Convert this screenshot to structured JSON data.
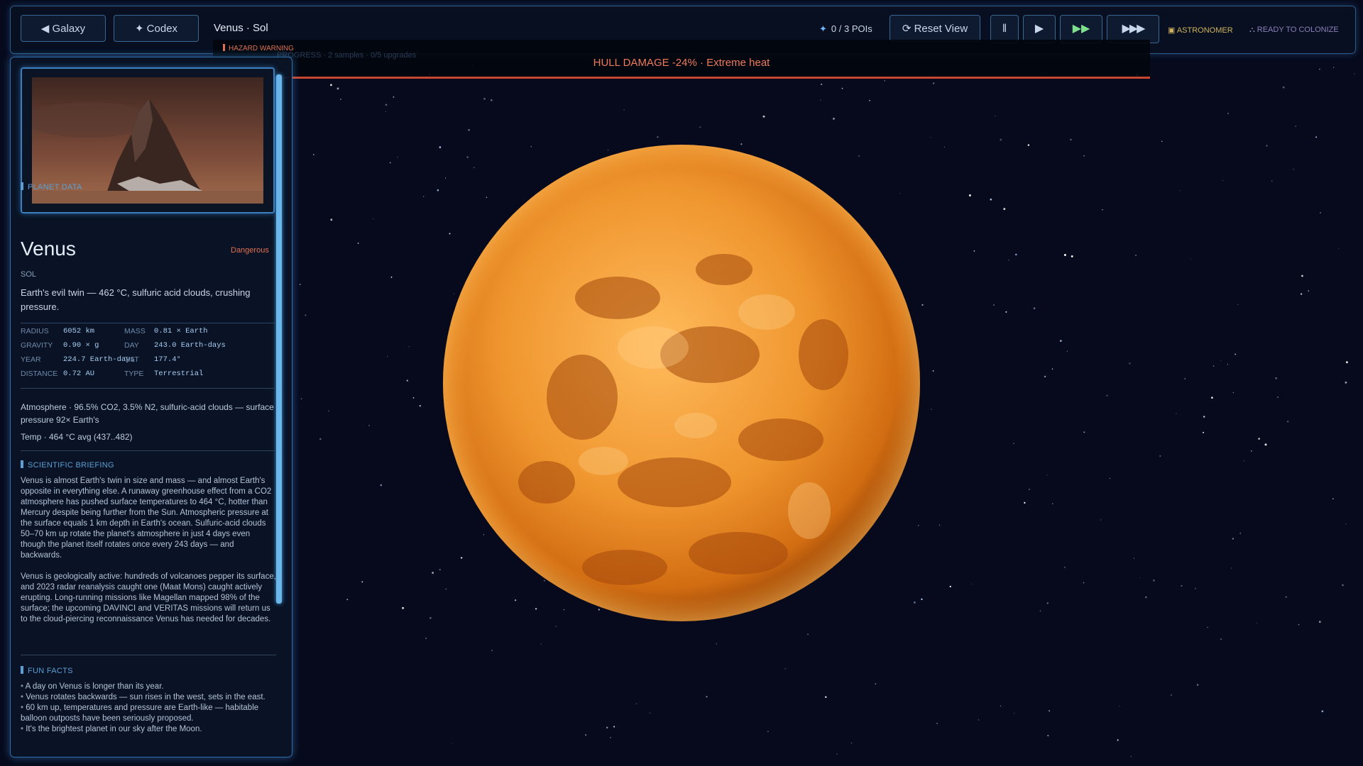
{
  "nav": {
    "galaxy_label": "◀ Galaxy",
    "codex_label": "✦ Codex",
    "breadcrumb": "Venus · Sol"
  },
  "toolbar": {
    "pois": "0 / 3 POIs",
    "reset_label": "⟳ Reset View",
    "pause_label": "‖",
    "play_label": "▶",
    "fast_label": "▶▶",
    "faster_label": "▶▶▶",
    "astronomer_badge": "▣ ASTRONOMER",
    "colonize_badge": "⛬ READY TO COLONIZE"
  },
  "hazard": {
    "tag": "HAZARD WARNING",
    "ghost_text": "PROGRESS · 2 samples · 0/5 upgrades",
    "message": "HULL DAMAGE -24%  ·  Extreme heat"
  },
  "panel": {
    "section_planet": "PLANET DATA",
    "name": "Venus",
    "danger": "Dangerous",
    "system": "SOL",
    "description": "Earth's evil twin — 462 °C, sulfuric acid clouds, crushing pressure.",
    "stats": [
      {
        "l1": "RADIUS",
        "v1": "6052 km",
        "l2": "MASS",
        "v2": "0.81 × Earth"
      },
      {
        "l1": "GRAVITY",
        "v1": "0.90 × g",
        "l2": "DAY",
        "v2": "243.0 Earth-days"
      },
      {
        "l1": "YEAR",
        "v1": "224.7 Earth-days",
        "l2": "TILT",
        "v2": "177.4°"
      },
      {
        "l1": "DISTANCE",
        "v1": "0.72 AU",
        "l2": "TYPE",
        "v2": "Terrestrial"
      }
    ],
    "atmosphere": "Atmosphere · 96.5% CO2, 3.5% N2, sulfuric-acid clouds — surface pressure 92× Earth's",
    "temp": "Temp · 464 °C avg (437..482)",
    "section_briefing": "SCIENTIFIC BRIEFING",
    "briefing_p1": "Venus is almost Earth's twin in size and mass — and almost Earth's opposite in everything else. A runaway greenhouse effect from a CO2 atmosphere has pushed surface temperatures to 464 °C, hotter than Mercury despite being further from the Sun. Atmospheric pressure at the surface equals 1 km depth in Earth's ocean. Sulfuric-acid clouds 50–70 km up rotate the planet's atmosphere in just 4 days even though the planet itself rotates once every 243 days — and backwards.",
    "briefing_p2": "Venus is geologically active: hundreds of volcanoes pepper its surface, and 2023 radar reanalysis caught one (Maat Mons) caught actively erupting. Long-running missions like Magellan mapped 98% of the surface; the upcoming DAVINCI and VERITAS missions will return us to the cloud-piercing reconnaissance Venus has needed for decades.",
    "section_facts": "FUN FACTS",
    "facts": [
      "A day on Venus is longer than its year.",
      "Venus rotates backwards — sun rises in the west, sets in the east.",
      "60 km up, temperatures and pressure are Earth-like — habitable balloon outposts have been seriously proposed.",
      "It's the brightest planet in our sky after the Moon."
    ]
  },
  "colors": {
    "accent": "#5b9fd4",
    "danger": "#e07050",
    "planet": "#e88a2a"
  }
}
